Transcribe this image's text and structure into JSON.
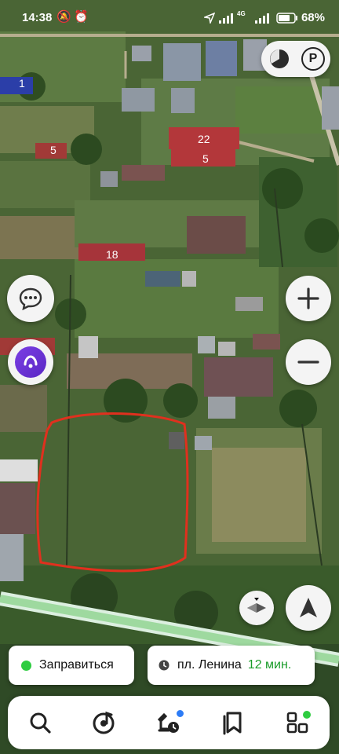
{
  "status_bar": {
    "time": "14:38",
    "network": "4G",
    "battery": "68%"
  },
  "map": {
    "house_numbers": [
      "1",
      "5",
      "22",
      "5",
      "18"
    ],
    "colors": {
      "highlight": "#e0301e",
      "road": "#bfe8c0"
    }
  },
  "chips": {
    "refuel_label": "Заправиться",
    "destination_label": "пл. Ленина",
    "eta": "12 мин.",
    "refuel_dot_color": "#2ecc40",
    "eta_color": "#1a9c2a"
  },
  "icons": {
    "layers": "layers-icon",
    "parking": "parking-icon",
    "chat": "chat-icon",
    "alice": "alice-assistant-icon",
    "zoom_in": "plus-icon",
    "zoom_out": "minus-icon",
    "compass": "compass-icon",
    "location": "navigation-arrow-icon"
  },
  "parking_letter": "P",
  "bottom_nav": [
    "search-icon",
    "music-icon",
    "navigator-icon",
    "bookmarks-icon",
    "services-icon"
  ]
}
